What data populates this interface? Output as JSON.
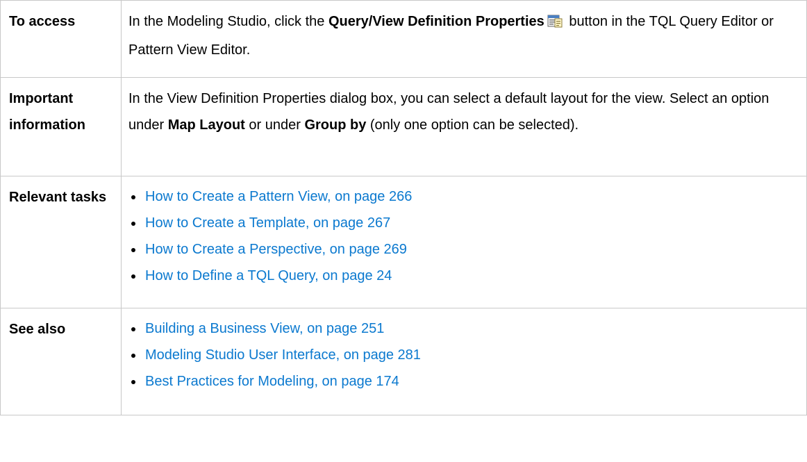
{
  "access": {
    "label": "To access",
    "text1": "In the Modeling Studio, click the ",
    "bold": "Query/View Definition Properties",
    "text2": " button in the TQL Query Editor or Pattern View Editor.",
    "icon": "properties-icon"
  },
  "important": {
    "label": "Important information",
    "text1": "In the View Definition Properties dialog box, you can select a default layout for the view. Select an option under ",
    "bold1": "Map Layout",
    "text2": " or under ",
    "bold2": "Group by",
    "text3": " (only one option can be selected)."
  },
  "tasks": {
    "label": "Relevant tasks",
    "links": [
      "How to Create a Pattern View, on page 266",
      "How to Create a Template, on page 267",
      "How to Create a Perspective, on page 269",
      "How to Define a TQL Query, on page 24"
    ]
  },
  "see_also": {
    "label": "See also",
    "links": [
      "Building a Business View, on page 251",
      "Modeling Studio User Interface, on page 281",
      "Best Practices for Modeling, on page 174"
    ]
  },
  "colors": {
    "link": "#0b79cf",
    "border": "#c8c8c8"
  }
}
